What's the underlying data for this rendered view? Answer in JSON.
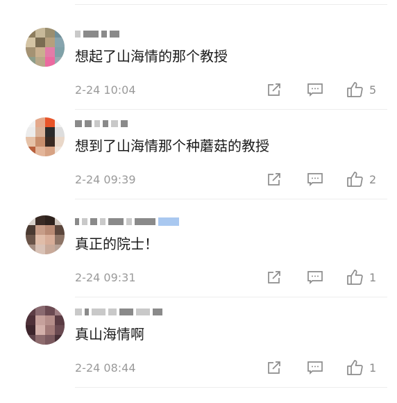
{
  "comments": [
    {
      "username": "",
      "text": "想起了山海情的那个教授",
      "time": "2-24 10:04",
      "likes": "5",
      "avatar": "pixelated-avatar",
      "icons": {
        "share": "share-icon",
        "reply": "comment-icon",
        "like": "thumbs-up-icon"
      }
    },
    {
      "username": "",
      "text": "想到了山海情那个种蘑菇的教授",
      "time": "2-24 09:39",
      "likes": "2",
      "avatar": "pixelated-avatar",
      "icons": {
        "share": "share-icon",
        "reply": "comment-icon",
        "like": "thumbs-up-icon"
      }
    },
    {
      "username": "",
      "text": "真正的院士！",
      "time": "2-24 09:31",
      "likes": "1",
      "avatar": "pixelated-avatar",
      "icons": {
        "share": "share-icon",
        "reply": "comment-icon",
        "like": "thumbs-up-icon"
      }
    },
    {
      "username": "",
      "text": "真山海情啊",
      "time": "2-24 08:44",
      "likes": "1",
      "avatar": "pixelated-avatar",
      "icons": {
        "share": "share-icon",
        "reply": "comment-icon",
        "like": "thumbs-up-icon"
      }
    }
  ],
  "colors": {
    "text": "#1a1a1a",
    "meta": "#9a9a9a",
    "icon": "#8c8c8c",
    "divider": "#ededed"
  }
}
